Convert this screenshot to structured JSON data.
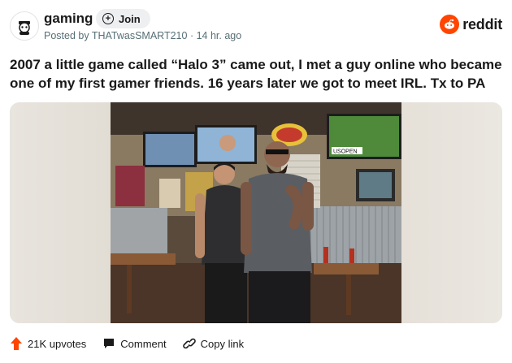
{
  "subreddit": {
    "name": "gaming",
    "join_label": "Join",
    "posted_by": "Posted by THATwasSMART210",
    "time_ago": "14 hr. ago"
  },
  "brand": {
    "word": "reddit",
    "color": "#ff4500"
  },
  "post": {
    "title": "2007 a little game called “Halo 3” came out, I met a guy online who became one of my first gamer friends. 16 years later we got to meet IRL. Tx to PA"
  },
  "photo": {
    "signs": {
      "tv_right_label": "USOPEN"
    }
  },
  "actions": {
    "upvotes": "21K upvotes",
    "comment": "Comment",
    "copy_link": "Copy link"
  },
  "icons": {
    "avatar": "gaming-subreddit-icon",
    "join": "plus-circle-icon",
    "brand": "reddit-logo-icon",
    "upvote": "upvote-arrow-icon",
    "comment": "comment-bubble-icon",
    "copy_link": "link-icon"
  }
}
